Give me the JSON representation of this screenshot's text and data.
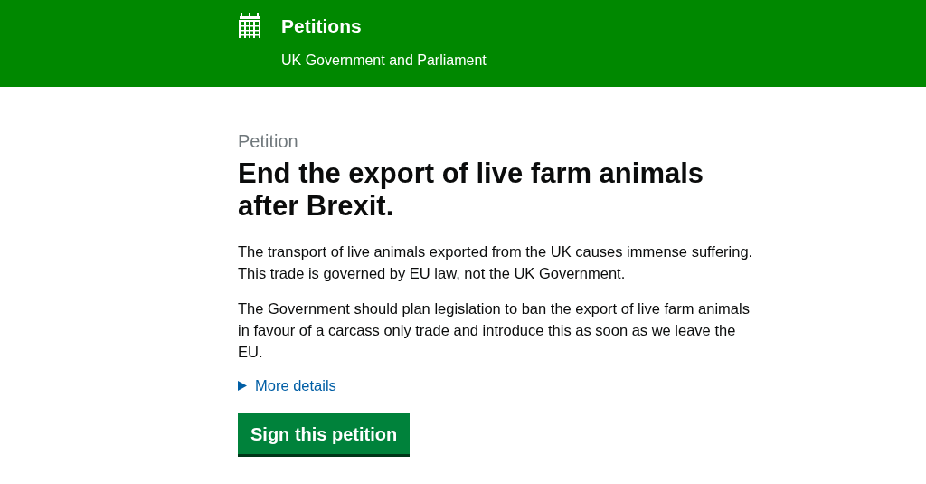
{
  "header": {
    "title": "Petitions",
    "subtitle": "UK Government and Parliament"
  },
  "petition": {
    "caption": "Petition",
    "title": "End the export of live farm animals after Brexit.",
    "paragraphs": [
      "The transport of live animals exported from the UK causes immense suffering. This trade is governed by EU law, not the UK Government.",
      "The Government should plan legislation to ban the export of live farm animals in favour of a carcass only trade and introduce this as soon as we leave the EU."
    ],
    "details": {
      "label": "More details",
      "expanded": false
    },
    "button": "Sign this petition"
  }
}
